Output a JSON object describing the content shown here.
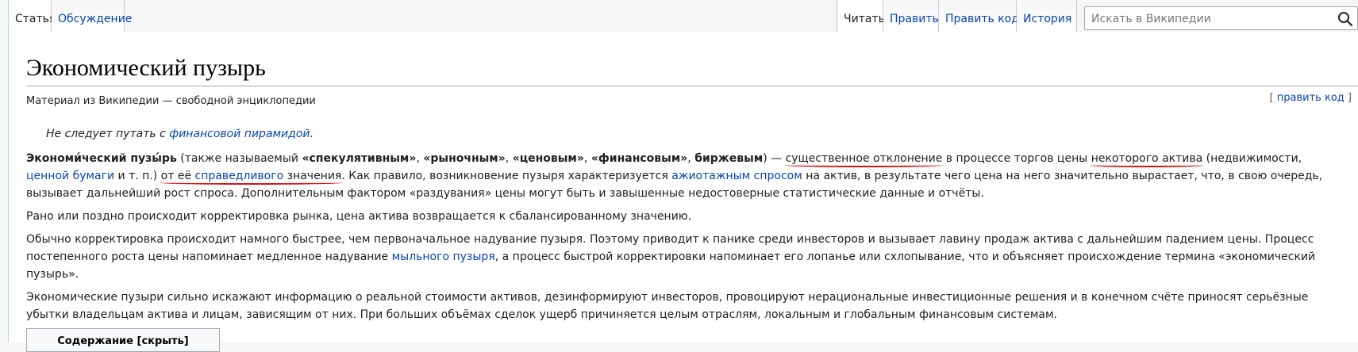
{
  "tabs_left": [
    {
      "label": "Статья",
      "selected": true
    },
    {
      "label": "Обсуждение",
      "selected": false
    }
  ],
  "tabs_right": [
    {
      "label": "Читать",
      "selected": true
    },
    {
      "label": "Править",
      "selected": false
    },
    {
      "label": "Править код",
      "selected": false
    },
    {
      "label": "История",
      "selected": false
    }
  ],
  "search": {
    "placeholder": "Искать в Википедии",
    "value": ""
  },
  "page": {
    "title": "Экономический пузырь",
    "subtitle": "Материал из Википедии — свободной энциклопедии",
    "edit_open": "[ ",
    "edit_label": "править код",
    "edit_close": " ]",
    "hatnote_pre": "Не следует путать с ",
    "hatnote_link": "финансовой пирамидой",
    "hatnote_post": "."
  },
  "paragraphs": {
    "p1": {
      "b1": "Экономи́ческий пузы́рь",
      "t1": " (также называемый ",
      "b2": "«спекулятивным»",
      "t2": ", ",
      "b3": "«рыночным»",
      "t3": ", ",
      "b4": "«ценовым»",
      "t4": ", ",
      "b5": "«финансовым»",
      "t5": ", ",
      "b6": "биржевым",
      "t6": ") — ",
      "u1": "существенное отклонение",
      "t7": " в процессе торгов цены ",
      "u2": "некоторого актива",
      "t8": " (недвижимости, ",
      "l1": "ценной бумаги",
      "t9": " и т. п.) ",
      "u3a": "от её ",
      "l2": "справедливого",
      "u3b": " значения",
      "t10": ". Как правило, возникновение пузыря характеризуется ",
      "l3": "ажиотажным спросом",
      "t11": " на актив, в результате чего цена на него значительно вырастает, что, в свою очередь, вызывает дальнейший рост спроса. Дополнительным фактором «раздувания» цены могут быть и завышенные недостоверные статистические данные и отчёты."
    },
    "p2": "Рано или поздно происходит корректировка рынка, цена актива возвращается к сбалансированному значению.",
    "p3": {
      "t1": "Обычно корректировка происходит намного быстрее, чем первоначальное надувание пузыря. Поэтому приводит к панике среди инвесторов и вызывает лавину продаж актива с дальнейшим падением цены. Процесс постепенного роста цены напоминает медленное надувание ",
      "l1": "мыльного пузыря",
      "t2": ", а процесс быстрой корректировки напоминает его лопанье или схлопывание, что и объясняет происхождение термина «экономический пузырь»."
    },
    "p4": "Экономические пузыри сильно искажают информацию о реальной стоимости активов, дезинформируют инвесторов, провоцируют нерациональные инвестиционные решения и в конечном счёте приносят серьёзные убытки владельцам актива и лицам, зависящим от них. При больших объёмах сделок ущерб причиняется целым отраслям, локальным и глобальным финансовым системам."
  },
  "toc": {
    "label": "Содержание [скрыть]"
  }
}
